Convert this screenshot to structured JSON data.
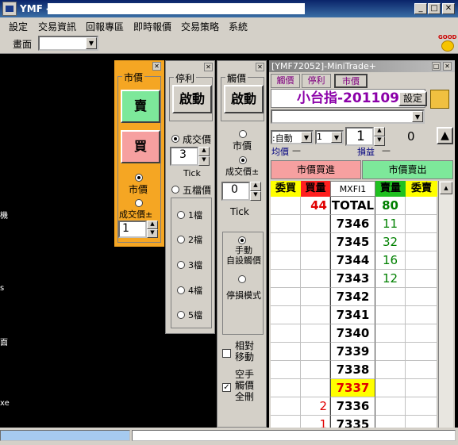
{
  "app": {
    "title": "YMF -",
    "logo_text": "FMY"
  },
  "window_buttons": {
    "min": "_",
    "max": "□",
    "close": "✕"
  },
  "menu": [
    "設定",
    "交易資訊",
    "回報專區",
    "即時報價",
    "交易策略",
    "系統"
  ],
  "toolbar": {
    "screen_label": "畫面",
    "screen_value": ""
  },
  "good_badge": {
    "text": "GOOD",
    "icon": "smiley-icon"
  },
  "left_fragments": [
    "機",
    "s",
    "面",
    "xe"
  ],
  "market_panel": {
    "group_label": "市價",
    "sell_label": "賣",
    "buy_label": "買",
    "radio_market": "市價",
    "radio_trade": "成交價±",
    "qty": "1",
    "sell_color": "#7de89a",
    "buy_color": "#f6a0a0"
  },
  "profit_panel": {
    "group_label": "停利",
    "start_label": "啟動",
    "radio_trade": "成交價",
    "tick_value": "3",
    "tick_label": "Tick",
    "radio_five": "五檔價",
    "levels": [
      "1檔",
      "2檔",
      "3檔",
      "4檔",
      "5檔"
    ]
  },
  "trigger_panel": {
    "group_label": "觸價",
    "start_label": "啟動",
    "radio_market": "市價",
    "radio_trade": "成交價±",
    "tick_value": "0",
    "tick_label": "Tick",
    "mode_manual": "手動\n自設觸價",
    "mode_stop": "停損模式",
    "relative_move": "相對\n移動",
    "empty_delete": "空手\n觸價\n全刪"
  },
  "minitrade": {
    "title": "[YMF72052]-MiniTrade+",
    "tabs": [
      "觸價",
      "停利",
      "市價"
    ],
    "product": "小台指-201109",
    "settings_label": "設定",
    "mode_value": ":自動",
    "mode_qty": "1",
    "order_qty": "1",
    "position": "0",
    "avg_label": "均價",
    "avg_value": "—",
    "pnl_label": "損益",
    "pnl_value": "—",
    "market_buy": "市價買進",
    "market_sell": "市價賣出",
    "columns": [
      "委買",
      "買量",
      "MXFI1",
      "賣量",
      "委賣"
    ],
    "total": {
      "bid_qty": "44",
      "label": "TOTAL",
      "ask_qty": "80"
    },
    "rows": [
      {
        "price": "7346",
        "bid": "",
        "ask": "11",
        "hl": false
      },
      {
        "price": "7345",
        "bid": "",
        "ask": "32",
        "hl": false
      },
      {
        "price": "7344",
        "bid": "",
        "ask": "16",
        "hl": false
      },
      {
        "price": "7343",
        "bid": "",
        "ask": "12",
        "hl": false
      },
      {
        "price": "7342",
        "bid": "",
        "ask": "",
        "hl": false
      },
      {
        "price": "7341",
        "bid": "",
        "ask": "",
        "hl": false
      },
      {
        "price": "7340",
        "bid": "",
        "ask": "",
        "hl": false
      },
      {
        "price": "7339",
        "bid": "",
        "ask": "",
        "hl": false
      },
      {
        "price": "7338",
        "bid": "",
        "ask": "",
        "hl": false
      },
      {
        "price": "7337",
        "bid": "",
        "ask": "",
        "hl": true
      },
      {
        "price": "7336",
        "bid": "2",
        "ask": "",
        "hl": false
      },
      {
        "price": "7335",
        "bid": "1",
        "ask": "",
        "hl": false
      }
    ]
  }
}
